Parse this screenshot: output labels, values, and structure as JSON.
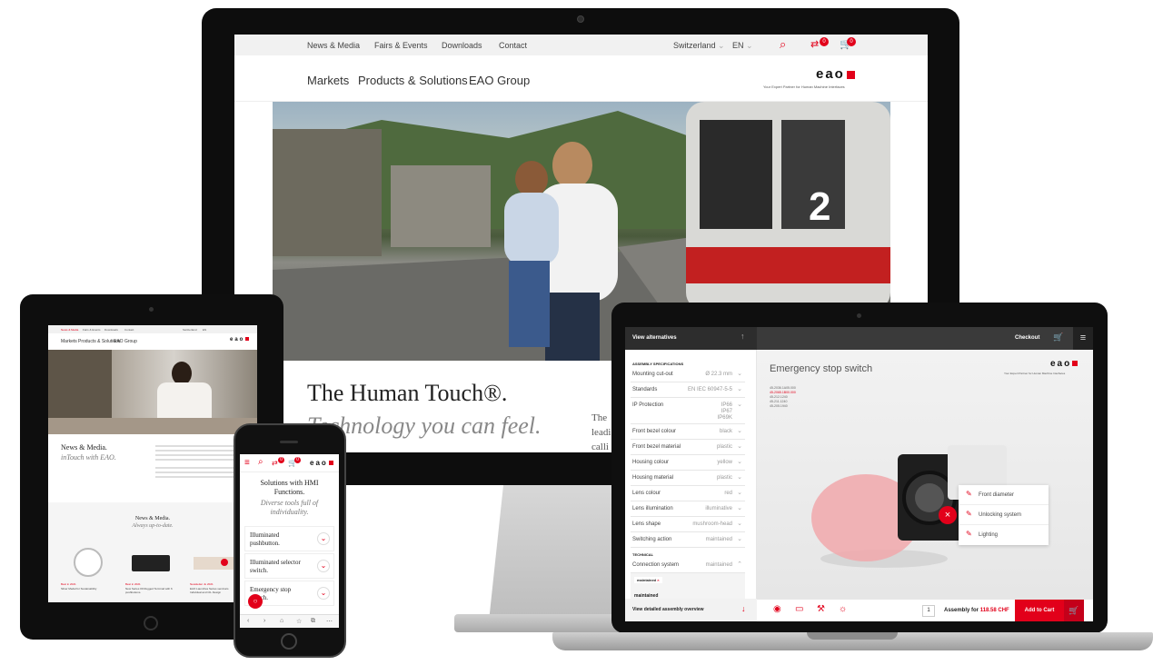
{
  "imac": {
    "topnav": [
      "News & Media",
      "Fairs & Events",
      "Downloads",
      "Contact"
    ],
    "country": "Switzerland",
    "lang": "EN",
    "cart_count": "0",
    "wishlist_count": "0",
    "mainnav": [
      "Markets",
      "Products & Solutions",
      "EAO Group"
    ],
    "logo": "eao",
    "tagline": "Your Expert Partner for Human Machine Interfaces",
    "headline": "The Human Touch",
    "headline_mark": "®.",
    "subheadline": "Technology you can feel.",
    "body_fragments": [
      "The",
      "leadi",
      "calli"
    ]
  },
  "ipad": {
    "topnav": [
      "News & Media",
      "Fairs & Events",
      "Downloads",
      "Contact"
    ],
    "country": "Switzerland",
    "lang": "EN",
    "mainnav": [
      "Markets",
      "Products & Solutions",
      "EAO Group"
    ],
    "logo": "eao",
    "news_title": "News & Media.",
    "news_sub": "inTouch with EAO.",
    "section_title": "News & Media.",
    "section_sub": "Always up-to-date.",
    "cards": [
      {
        "tag": "Best in 2021",
        "text": "Silver Medal for Sustainability"
      },
      {
        "tag": "Best in 2021",
        "text": "New Series 09 Rugged Terminal with 6 pushbuttons."
      },
      {
        "tag": "Newsletter Ju 2021",
        "text": "EAO Launches Series seminars Individual and CIL Design"
      }
    ]
  },
  "phone": {
    "logo": "eao",
    "cart_count": "0",
    "wishlist_count": "0",
    "title": "Solutions with HMI Functions.",
    "subtitle": "Diverse tools full of individuality.",
    "items": [
      "Illuminated pushbutton.",
      "Illuminated selector switch.",
      "Emergency stop switch."
    ]
  },
  "macbook": {
    "view_alternatives": "View alternatives",
    "checkout": "Checkout",
    "section_assembly": "ASSEMBLY SPECIFICATIONS",
    "specs": [
      {
        "label": "Mounting cut-out",
        "value": "Ø 22.3 mm"
      },
      {
        "label": "Standards",
        "value": "EN IEC 60947-5-5"
      },
      {
        "label": "IP Protection",
        "value": "IP66"
      },
      {
        "label": "Front bezel colour",
        "value": "black"
      },
      {
        "label": "Front bezel material",
        "value": "plastic"
      },
      {
        "label": "Housing colour",
        "value": "yellow"
      },
      {
        "label": "Housing material",
        "value": "plastic"
      },
      {
        "label": "Lens colour",
        "value": "red"
      },
      {
        "label": "Lens illumination",
        "value": "illuminative"
      },
      {
        "label": "Lens shape",
        "value": "mushroom-head"
      },
      {
        "label": "Switching action",
        "value": "maintained"
      }
    ],
    "ip_extra": [
      "IP67",
      "IP69K"
    ],
    "section_technical": "TECHNICAL",
    "connection_label": "Connection system",
    "connection_value": "maintained",
    "selected_chip": "maintained",
    "dropdown_option": "maintained",
    "view_detailed": "View detailed assembly overview",
    "product_title": "Emergency stop switch",
    "logo": "eao",
    "tagline": "Your Expert Partner for Human Machine Interfaces",
    "part_numbers": [
      "45-2036.1A05.000",
      "45-2065.1B00.000",
      "45-212.1240",
      "45-211.1240",
      "45-205.1940"
    ],
    "popup_options": [
      "Front diameter",
      "Unlocking system",
      "Lighting"
    ],
    "quantity": "1",
    "assembly_label": "Assembly for",
    "price": "118.58 CHF",
    "add_to_cart": "Add to Cart",
    "accent": "#e2001a"
  }
}
